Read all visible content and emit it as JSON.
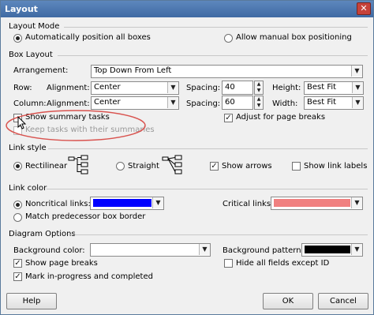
{
  "window": {
    "title": "Layout",
    "close_glyph": "✕"
  },
  "layout_mode": {
    "heading": "Layout Mode",
    "auto_label": "Automatically position all boxes",
    "manual_label": "Allow manual box positioning",
    "selected": "auto"
  },
  "box_layout": {
    "heading": "Box Layout",
    "arrangement_label": "Arrangement:",
    "arrangement_value": "Top Down From Left",
    "row_label": "Row:",
    "row_alignment_label": "Alignment:",
    "row_alignment_value": "Center",
    "row_spacing_label": "Spacing:",
    "row_spacing_value": "40",
    "height_label": "Height:",
    "height_value": "Best Fit",
    "column_label": "Column:",
    "column_alignment_label": "Alignment:",
    "column_alignment_value": "Center",
    "column_spacing_label": "Spacing:",
    "column_spacing_value": "60",
    "width_label": "Width:",
    "width_value": "Best Fit",
    "show_summary_label": "Show summary tasks",
    "show_summary_checked": false,
    "keep_tasks_label": "Keep tasks with their summaries",
    "keep_tasks_checked": false,
    "adjust_breaks_label": "Adjust for page breaks",
    "adjust_breaks_checked": true
  },
  "link_style": {
    "heading": "Link style",
    "rectilinear_label": "Rectilinear",
    "straight_label": "Straight",
    "selected": "rectilinear",
    "show_arrows_label": "Show arrows",
    "show_arrows_checked": true,
    "show_link_labels_label": "Show link labels",
    "show_link_labels_checked": false
  },
  "link_color": {
    "heading": "Link color",
    "noncritical_label": "Noncritical links:",
    "noncritical_color": "#0000ff",
    "critical_label": "Critical links:",
    "critical_color": "#f08080",
    "match_label": "Match predecessor box border",
    "selected": "noncritical"
  },
  "diagram_options": {
    "heading": "Diagram Options",
    "bg_color_label": "Background color:",
    "bg_color": "#ffffff",
    "bg_pattern_label": "Background pattern:",
    "bg_pattern": "#000000",
    "show_page_breaks_label": "Show page breaks",
    "show_page_breaks_checked": true,
    "hide_fields_label": "Hide all fields except ID",
    "hide_fields_checked": false,
    "mark_progress_label": "Mark in-progress and completed",
    "mark_progress_checked": true
  },
  "buttons": {
    "help": "Help",
    "ok": "OK",
    "cancel": "Cancel"
  },
  "glyphs": {
    "check": "✓",
    "dropdown": "▼",
    "spin_up": "▲",
    "spin_down": "▼"
  },
  "annotation": {
    "color": "#d9534f"
  }
}
